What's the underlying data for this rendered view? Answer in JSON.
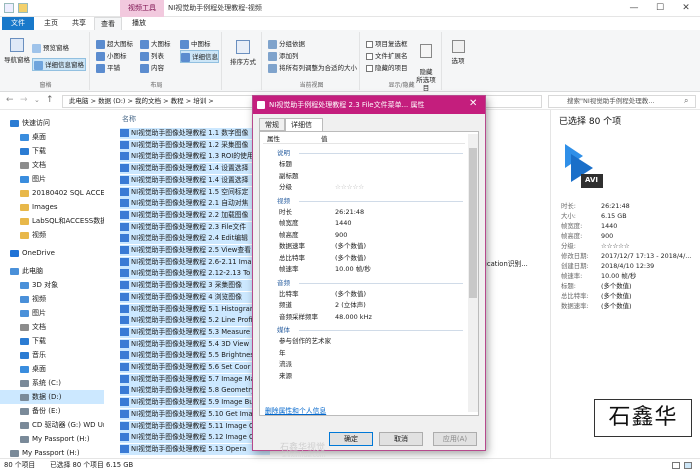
{
  "titlebar": {
    "context_tab": "视频工具",
    "title": "NI视觉助手例程处理教程-视频",
    "min": "—",
    "max": "☐",
    "close": "✕"
  },
  "tabs": [
    "文件",
    "主页",
    "共享",
    "查看",
    "播放"
  ],
  "ribbon": {
    "pane": {
      "nav_pane": "导航窗格",
      "preview": "预览窗格",
      "details": "详细信息窗格",
      "label": "窗格"
    },
    "layout": {
      "items": [
        "超大图标",
        "大图标",
        "中图标",
        "小图标",
        "列表",
        "详细信息",
        "平铺",
        "内容"
      ],
      "label": "布局"
    },
    "sort": {
      "label": "排序方式"
    },
    "current_view": {
      "items": [
        "分组依据",
        "添加列",
        "将所有列调整为合适的大小"
      ],
      "label": "当前视图"
    },
    "show_hide": {
      "items": [
        "项目复选框",
        "文件扩展名",
        "隐藏的项目"
      ],
      "hide_selected": "隐藏\n所选项目",
      "label": "显示/隐藏"
    },
    "options": "选项"
  },
  "address": {
    "path": [
      "此电脑",
      "数据 (D:)",
      "我的文档",
      "教程",
      "培训"
    ],
    "search_placeholder": "搜索\"NI视觉助手例程处理教..."
  },
  "navpane": [
    {
      "label": "快速访问",
      "color": "#2b7cd3"
    },
    {
      "label": "桌面",
      "color": "#3a8dde"
    },
    {
      "label": "下载",
      "color": "#2b7cd3"
    },
    {
      "label": "文档",
      "color": "#8c8c8c"
    },
    {
      "label": "图片",
      "color": "#3a8dde"
    },
    {
      "label": "20180402 SQL ACCESS",
      "color": "#e8b84a"
    },
    {
      "label": "Images",
      "color": "#e8b84a"
    },
    {
      "label": "LabSQL和ACCESS数据库",
      "color": "#e8b84a"
    },
    {
      "label": "视频",
      "color": "#e8b84a"
    },
    {
      "label": "OneDrive",
      "color": "#1f72d6"
    },
    {
      "label": "此电脑",
      "color": "#4a90d9"
    },
    {
      "label": "3D 对象",
      "color": "#4a90d9"
    },
    {
      "label": "视频",
      "color": "#4a90d9"
    },
    {
      "label": "图片",
      "color": "#4a90d9"
    },
    {
      "label": "文档",
      "color": "#8c8c8c"
    },
    {
      "label": "下载",
      "color": "#2b7cd3"
    },
    {
      "label": "音乐",
      "color": "#2b7cd3"
    },
    {
      "label": "桌面",
      "color": "#3a8dde"
    },
    {
      "label": "系统 (C:)",
      "color": "#7a8a99"
    },
    {
      "label": "数据 (D:)",
      "color": "#7a8a99"
    },
    {
      "label": "备份 (E:)",
      "color": "#7a8a99"
    },
    {
      "label": "CD 驱动器 (G:) WD Unl",
      "color": "#7a8a99"
    },
    {
      "label": "My Passport (H:)",
      "color": "#7a8a99"
    },
    {
      "label": "My Passport (H:)",
      "color": "#7a8a99"
    }
  ],
  "filelist": {
    "header": "名称",
    "files": [
      "NI视觉助手图像处理教程 1.1 数字图像",
      "NI视觉助手图像处理教程 1.2 采集图像",
      "NI视觉助手图像处理教程 1.3 ROI的使用",
      "NI视觉助手图像处理教程 1.4 设置选择",
      "NI视觉助手图像处理教程 1.4 设置选择",
      "NI视觉助手图像处理教程 1.5 空间标定",
      "NI视觉助手图像处理教程 2.1 自动对焦",
      "NI视觉助手图像处理教程 2.2 加载图像",
      "NI视觉助手图像处理教程 2.3 File文件",
      "NI视觉助手图像处理教程 2.4 Edit编辑",
      "NI视觉助手图像处理教程 2.5 View查看",
      "NI视觉助手图像处理教程 2.6-2.11 Imag",
      "NI视觉助手图像处理教程 2.12-2.13 To",
      "NI视觉助手图像处理教程 3 采集图像",
      "NI视觉助手图像处理教程 4 浏览图像",
      "NI视觉助手图像处理教程 5.1 Histogram",
      "NI视觉助手图像处理教程 5.2 Line Profi",
      "NI视觉助手图像处理教程 5.3 Measure",
      "NI视觉助手图像处理教程 5.4 3D View",
      "NI视觉助手图像处理教程 5.5 Brightnes",
      "NI视觉助手图像处理教程 5.6 Set Coor",
      "NI视觉助手图像处理教程 5.7 Image Ma",
      "NI视觉助手图像处理教程 5.8 Geometry",
      "NI视觉助手图像处理教程 5.9 Image Bu",
      "NI视觉助手图像处理教程 5.10 Get Ima",
      "NI视觉助手图像处理教程 5.11 Image C",
      "NI视觉助手图像处理教程 5.12 Image C",
      "NI视觉助手图像处理教程 5.13 Opera"
    ],
    "overflow_text": "tification识别..."
  },
  "details": {
    "selected": "已选择 80 个项",
    "file_badge": "AVI",
    "rows": [
      {
        "k": "时长:",
        "v": "26:21:48"
      },
      {
        "k": "大小:",
        "v": "6.15 GB"
      },
      {
        "k": "帧宽度:",
        "v": "1440"
      },
      {
        "k": "帧高度:",
        "v": "900"
      },
      {
        "k": "分级:",
        "v": "☆☆☆☆☆"
      },
      {
        "k": "修改日期:",
        "v": "2017/12/7 17:13 - 2018/4/..."
      },
      {
        "k": "创建日期:",
        "v": "2018/4/10 12:39"
      },
      {
        "k": "帧速率:",
        "v": "10.00 帧/秒"
      },
      {
        "k": "标题:",
        "v": "(多个数值)"
      },
      {
        "k": "总比特率:",
        "v": "(多个数值)"
      },
      {
        "k": "数据速率:",
        "v": "(多个数值)"
      }
    ]
  },
  "status": {
    "count": "80 个项目",
    "selected": "已选择 80 个项目",
    "size": "6.15 GB"
  },
  "dialog": {
    "title": "NI视觉助手例程处理教程 2.3 File文件菜单... 属性",
    "tabs": [
      "常规",
      "详细信息"
    ],
    "header_prop": "属性",
    "header_val": "值",
    "sections": [
      {
        "type": "head",
        "label": "说明"
      },
      {
        "type": "row",
        "k": "标题",
        "v": ""
      },
      {
        "type": "row",
        "k": "副标题",
        "v": ""
      },
      {
        "type": "row",
        "k": "分级",
        "v": "☆☆☆☆☆"
      },
      {
        "type": "head",
        "label": "视频"
      },
      {
        "type": "row",
        "k": "时长",
        "v": "26:21:48"
      },
      {
        "type": "row",
        "k": "帧宽度",
        "v": "1440"
      },
      {
        "type": "row",
        "k": "帧高度",
        "v": "900"
      },
      {
        "type": "row",
        "k": "数据速率",
        "v": "(多个数值)"
      },
      {
        "type": "row",
        "k": "总比特率",
        "v": "(多个数值)"
      },
      {
        "type": "row",
        "k": "帧速率",
        "v": "10.00 帧/秒"
      },
      {
        "type": "head",
        "label": "音频"
      },
      {
        "type": "row",
        "k": "比特率",
        "v": "(多个数值)"
      },
      {
        "type": "row",
        "k": "频道",
        "v": "2 (立体声)"
      },
      {
        "type": "row",
        "k": "音频采样频率",
        "v": "48.000 kHz"
      },
      {
        "type": "head",
        "label": "媒体"
      },
      {
        "type": "row",
        "k": "参与创作的艺术家",
        "v": ""
      },
      {
        "type": "row",
        "k": "年",
        "v": ""
      },
      {
        "type": "row",
        "k": "流派",
        "v": ""
      },
      {
        "type": "row",
        "k": "来源",
        "v": ""
      }
    ],
    "link": "删除属性和个人信息",
    "ok": "确定",
    "cancel": "取消",
    "apply": "应用(A)"
  },
  "watermark": {
    "logo": "石鑫华",
    "faint": "石鑫华视觉",
    "faint_url": "shixinhua.com"
  }
}
